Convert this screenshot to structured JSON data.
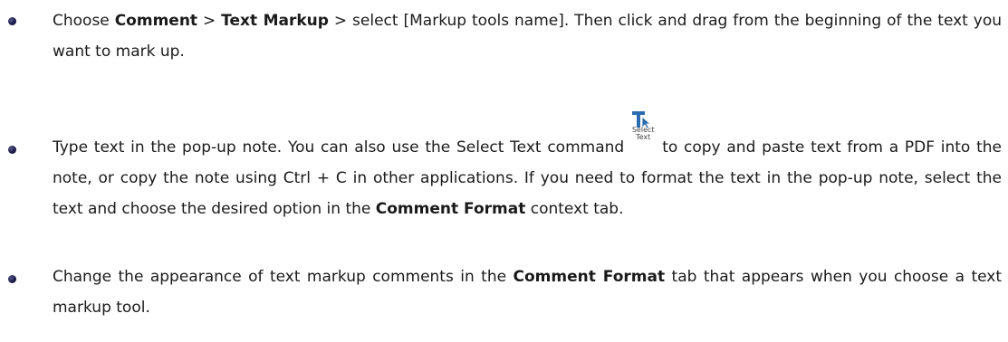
{
  "items": [
    {
      "prefix": "Choose ",
      "bold1": "Comment",
      "sep1": " > ",
      "bold2": "Text Markup",
      "suffix": " > select [Markup tools name]. Then click and drag from the beginning of the text you want to mark up."
    },
    {
      "part1": "Type text in the pop-up note. You can also use the Select Text command",
      "icon": {
        "name": "select-text-icon",
        "label_line1": "Select",
        "label_line2": "Text",
        "color": "#2b6cb0"
      },
      "part2": "to copy and paste text from a PDF into the note, or copy the note using Ctrl + C in other applications. If you need to format the text in the pop-up note, select the text and choose the desired option in the ",
      "bold": "Comment Format",
      "part3": " context tab."
    },
    {
      "prefix": "Change the appearance of text markup comments in the ",
      "bold": "Comment Format",
      "suffix": " tab that appears when you choose a text markup tool."
    }
  ],
  "colors": {
    "text": "#1a1a1a",
    "bullet": "#1a1a4a",
    "icon_blue": "#2b6cb0"
  }
}
